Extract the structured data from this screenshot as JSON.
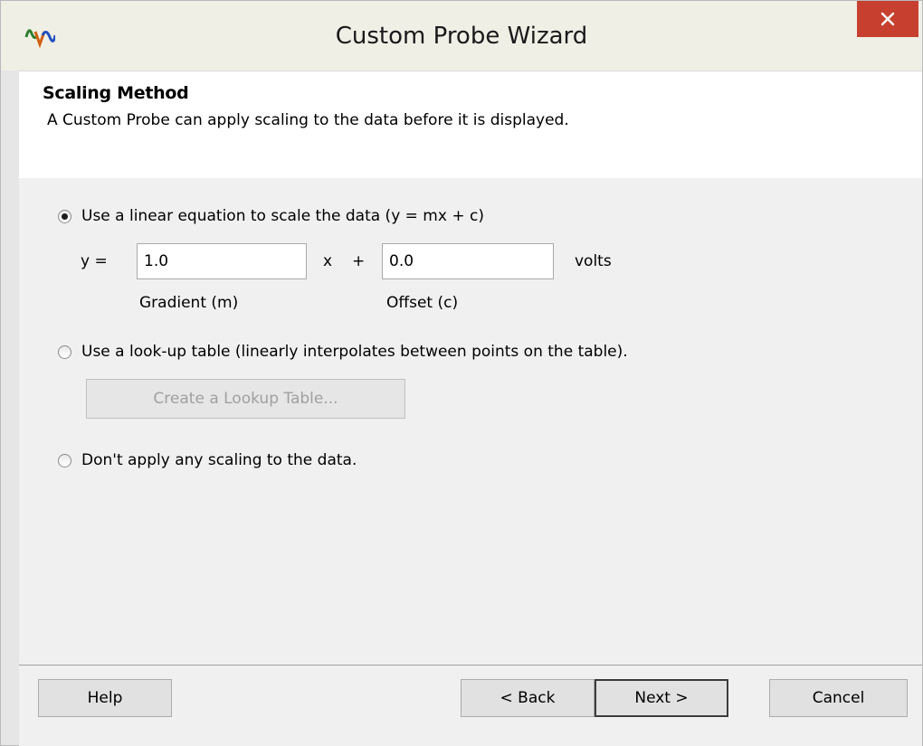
{
  "window": {
    "title": "Custom Probe Wizard",
    "close_symbol": "✕",
    "app_icon": "waveform-app-icon"
  },
  "header": {
    "title": "Scaling Method",
    "description": "A Custom Probe can apply scaling to the data before it is displayed."
  },
  "options": {
    "linear": {
      "label": "Use a linear equation to scale the data (y = mx + c)",
      "selected": true,
      "y_label": "y =",
      "gradient_value": "1.0",
      "x_label": "x",
      "plus_label": "+",
      "offset_value": "0.0",
      "unit_label": "volts",
      "gradient_caption": "Gradient (m)",
      "offset_caption": "Offset (c)"
    },
    "lookup": {
      "label": "Use a look-up table (linearly interpolates between points on the table).",
      "selected": false,
      "button_label": "Create a Lookup Table..."
    },
    "none": {
      "label": "Don't apply any scaling to the data.",
      "selected": false
    }
  },
  "footer": {
    "help": "Help",
    "back": "< Back",
    "next": "Next >",
    "cancel": "Cancel"
  },
  "colors": {
    "close_button": "#c7402f",
    "titlebar": "#f0efe5",
    "dialog_bg": "#f0f0f0"
  }
}
